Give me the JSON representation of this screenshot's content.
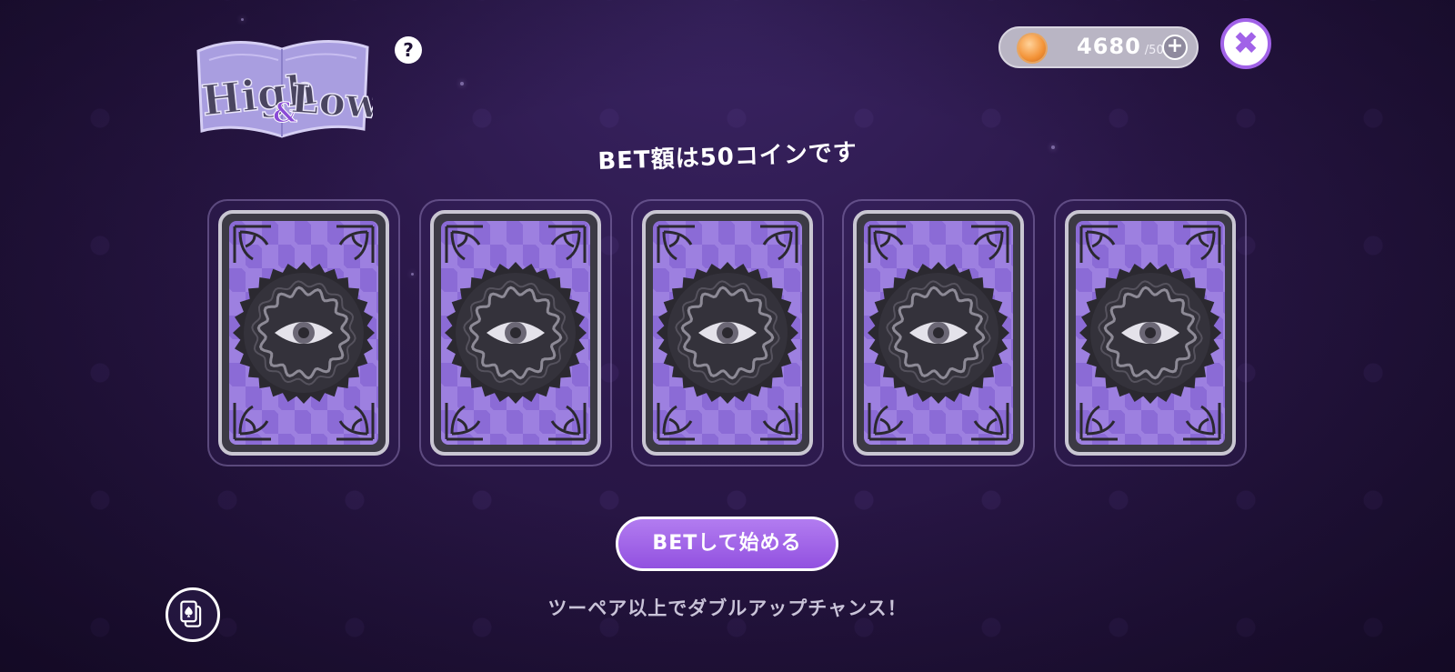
{
  "logo": {
    "text_main": "High",
    "text_amp": "&",
    "text_second": "Low"
  },
  "help": {
    "label": "?"
  },
  "coins": {
    "amount": "4680",
    "bet": "/50",
    "plus_label": "+"
  },
  "close": {
    "label": "✖"
  },
  "bet_message": "BET額は50コインです",
  "cards": [
    {
      "icon": "eye-icon"
    },
    {
      "icon": "eye-icon"
    },
    {
      "icon": "eye-icon"
    },
    {
      "icon": "eye-icon"
    },
    {
      "icon": "eye-icon"
    }
  ],
  "start_button": {
    "label": "BETして始める"
  },
  "subtitle": "ツーペア以上でダブルアップチャンス！",
  "deck_button": {
    "icon": "card-deck-icon"
  },
  "colors": {
    "accent": "#a162e8",
    "card_purple": "#8b6bd6",
    "background": "#2a1748"
  }
}
